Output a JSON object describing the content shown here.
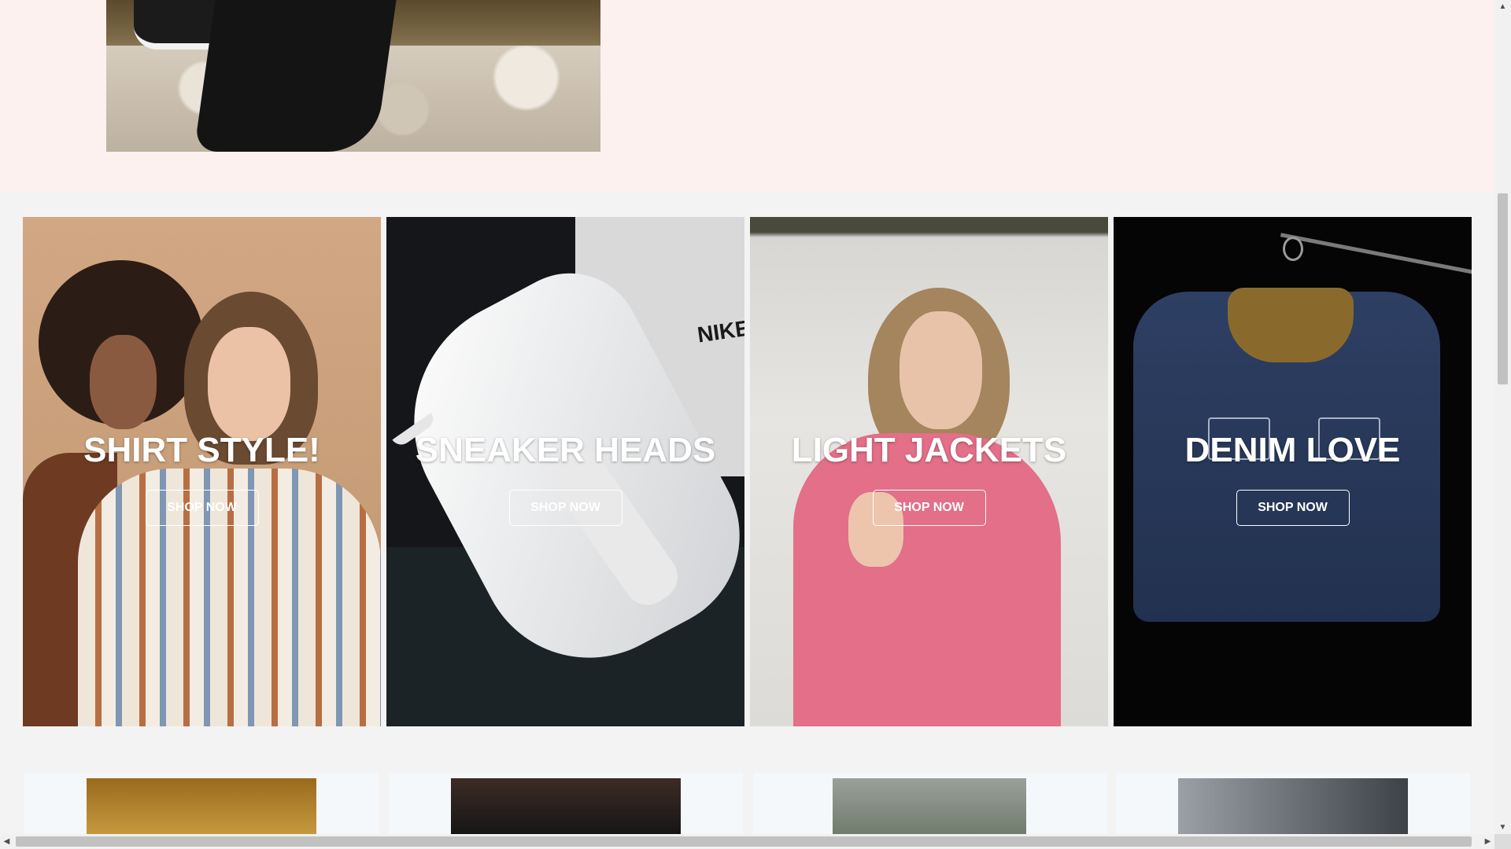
{
  "cards": [
    {
      "title": "SHIRT STYLE!",
      "button": "SHOP NOW"
    },
    {
      "title": "SNEAKER HEADS",
      "button": "SHOP NOW"
    },
    {
      "title": "LIGHT JACKETS",
      "button": "SHOP NOW"
    },
    {
      "title": "DENIM LOVE",
      "button": "SHOP NOW"
    }
  ],
  "brand_text": {
    "nike": "NIKE"
  },
  "colors": {
    "top_section_bg": "#fcf1ee",
    "page_bg": "#f3f3f3",
    "mini_card_bg": "#f4f8fa",
    "button_border": "#ffffff"
  },
  "scrollbars": {
    "up": "▲",
    "down": "▼",
    "left": "◀",
    "right": "▶"
  }
}
